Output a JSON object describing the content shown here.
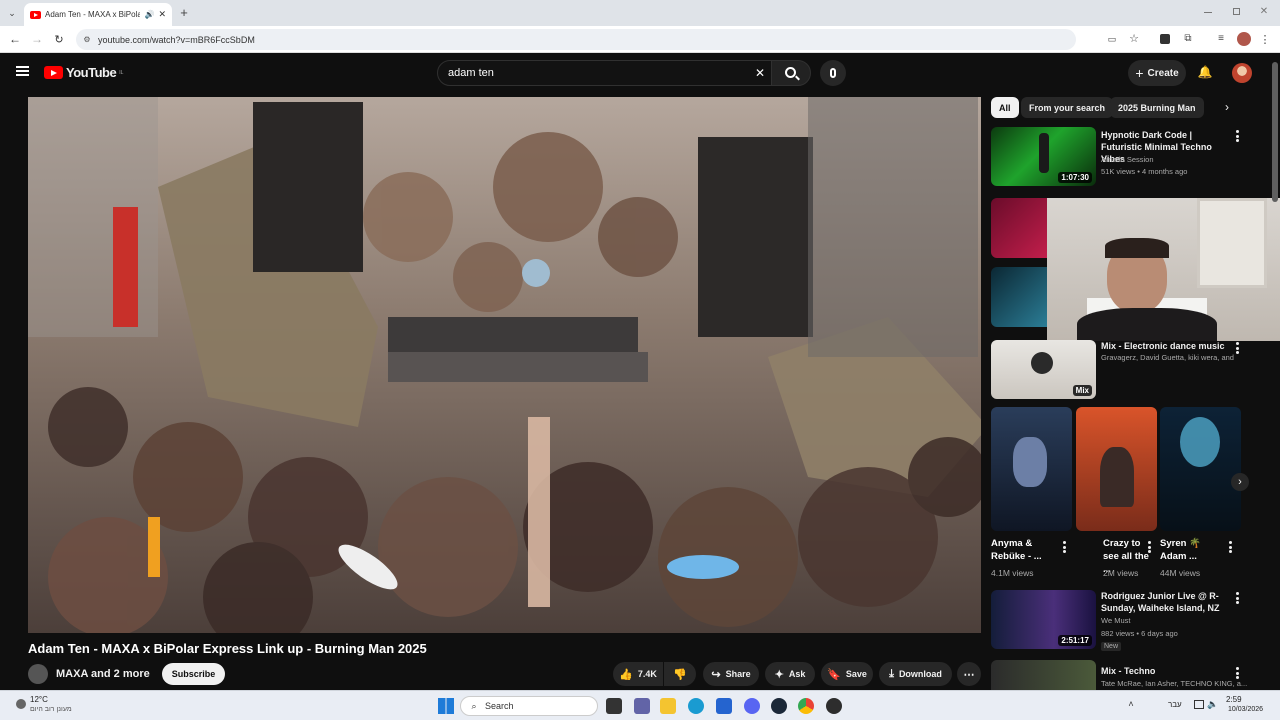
{
  "browser": {
    "tab_title": "Adam Ten - MAXA x BiPolar",
    "url": "youtube.com/watch?v=mBR6FccSbDM"
  },
  "youtube": {
    "logo_text": "YouTube",
    "country_code": "IL",
    "search_value": "adam ten",
    "create_label": "Create"
  },
  "video": {
    "title": "Adam Ten - MAXA x BiPolar Express Link up - Burning Man 2025",
    "channel": "MAXA and 2 more",
    "subscribe_label": "Subscribe",
    "like_count": "7.4K",
    "share_label": "Share",
    "ask_label": "Ask",
    "save_label": "Save",
    "download_label": "Download"
  },
  "chips": [
    "All",
    "From your search",
    "2025 Burning Man"
  ],
  "recommendations": [
    {
      "title": "Hypnotic Dark Code | Futuristic Minimal Techno Vibes",
      "channel": "Amoda Session",
      "meta": "51K views • 4 months ago",
      "duration": "1:07:30"
    },
    {
      "title": "Mix - Electronic dance music",
      "channel": "Gravagerz, David Guetta, kiki wera, and ...",
      "badge": "Mix"
    },
    {
      "title": "Rodriguez Junior Live @ R-Sunday, Waiheke Island, NZ",
      "channel": "We Must",
      "meta": "882 views • 6 days ago",
      "badge": "New",
      "duration": "2:51:17"
    },
    {
      "title": "Mix - Techno",
      "channel": "Tate McRae, Ian Asher, TECHNO KING, a..."
    }
  ],
  "shorts": [
    {
      "title": "Anyma & Rebüke - ...",
      "views": "4.1M views"
    },
    {
      "title": "Crazy to see all the ...",
      "views": "2M views"
    },
    {
      "title": "Syren 🌴 Adam ...",
      "views": "44M views"
    }
  ],
  "taskbar": {
    "weather_temp": "12°C",
    "weather_desc": "מעונן רוב היום",
    "search_placeholder": "Search",
    "time": "2:59",
    "date": "10/03/2026",
    "lang": "עבר"
  },
  "colors": {
    "yt_red": "#ff0000",
    "bg": "#0f0f0f",
    "chip_active": "#f1f1f1"
  }
}
